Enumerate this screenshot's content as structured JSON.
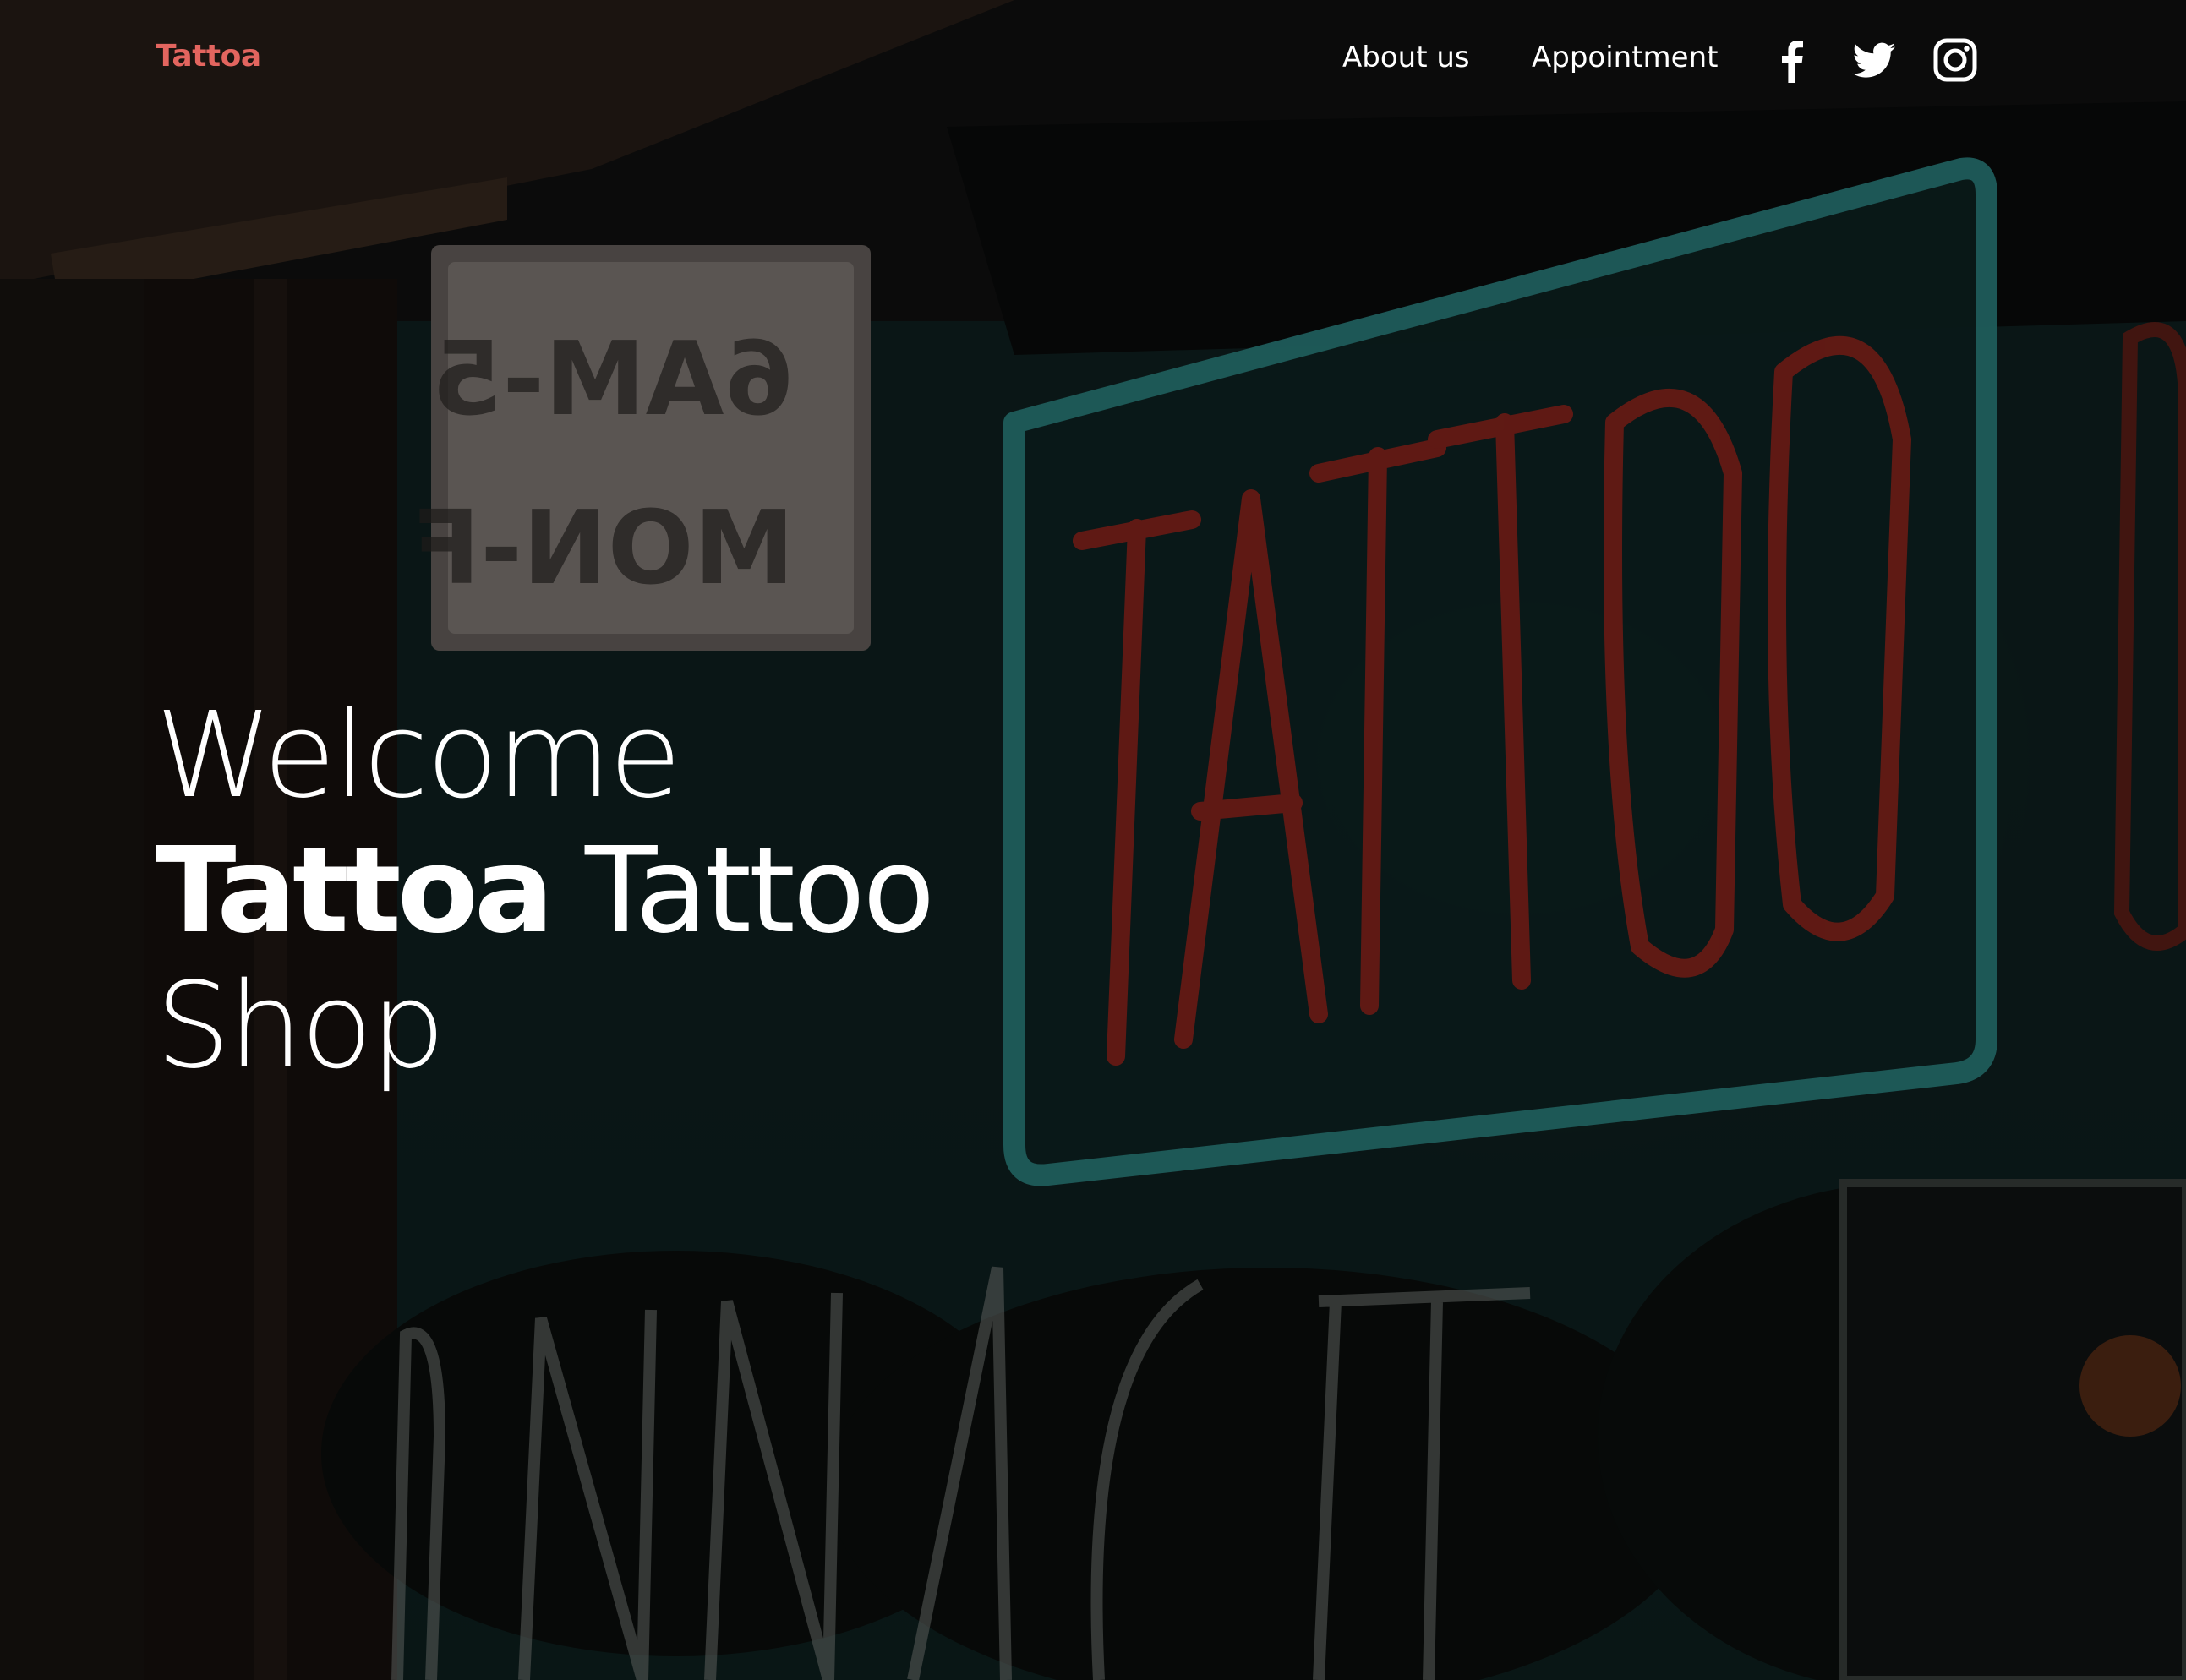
{
  "header": {
    "logo": "Tattoa",
    "nav": {
      "about_label": "About us",
      "appointment_label": "Appointment"
    },
    "social_icons": [
      "facebook-icon",
      "twitter-icon",
      "instagram-icon"
    ]
  },
  "hero": {
    "line1": "Welcome",
    "line2_bold": "Tattoa",
    "line2_light": "Tattoo",
    "line3": "Shop"
  },
  "colors": {
    "brand_accent": "#e3655f",
    "text": "#ffffff",
    "background": "#0d0c0c",
    "neon_teal": "#1f6f6d",
    "neon_red": "#a32a22"
  }
}
